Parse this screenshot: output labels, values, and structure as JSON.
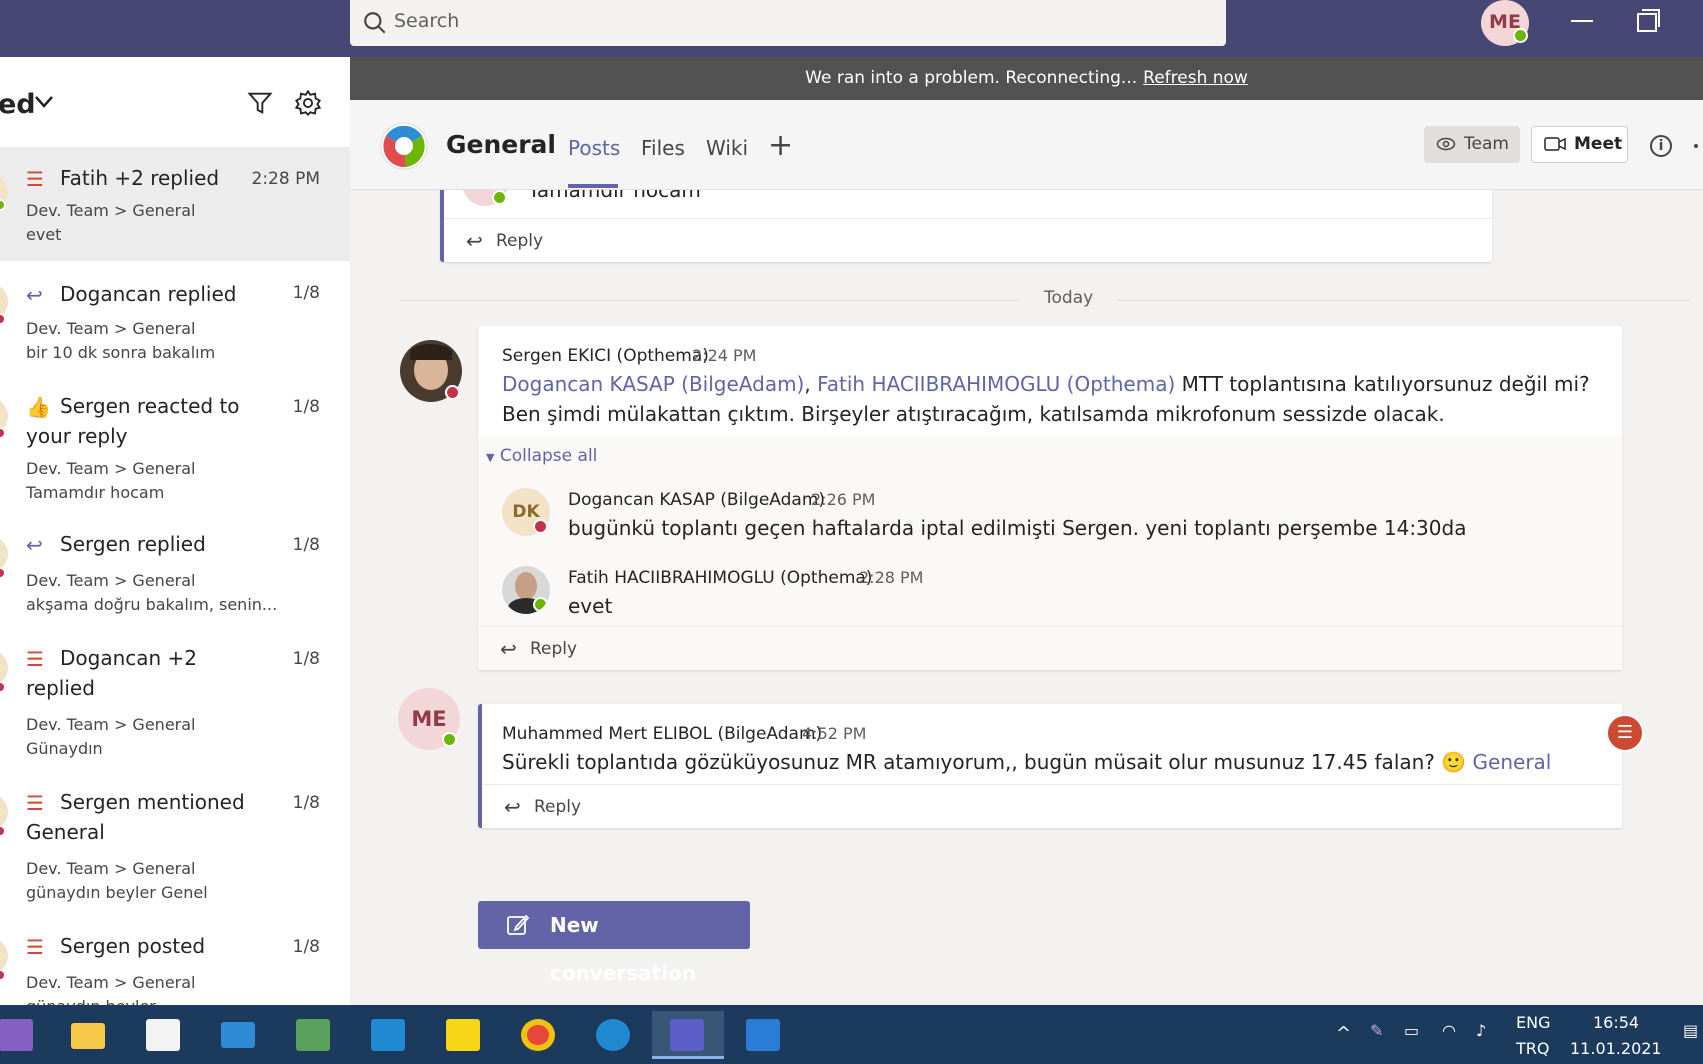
{
  "search": {
    "placeholder": "Search"
  },
  "user": {
    "initials": "ME"
  },
  "activity": {
    "header_title": "ed",
    "items": [
      {
        "title": "Fatih +2 replied",
        "time": "2:28 PM",
        "path": "Dev. Team > General",
        "snippet": "evet",
        "icon": "thread-icon"
      },
      {
        "title": "Dogancan replied",
        "time": "1/8",
        "path": "Dev. Team > General",
        "snippet": "bir 10 dk sonra bakalım",
        "icon": "reply-icon"
      },
      {
        "title": "Sergen reacted to your reply",
        "time": "1/8",
        "path": "Dev. Team > General",
        "snippet": "Tamamdır hocam",
        "icon": "like-icon"
      },
      {
        "title": "Sergen replied",
        "time": "1/8",
        "path": "Dev. Team > General",
        "snippet": "akşama doğru bakalım, senin...",
        "icon": "reply-icon"
      },
      {
        "title": "Dogancan +2 replied",
        "time": "1/8",
        "path": "Dev. Team > General",
        "snippet": "Günaydın",
        "icon": "thread-icon"
      },
      {
        "title": "Sergen mentioned General",
        "time": "1/8",
        "path": "Dev. Team > General",
        "snippet": "günaydın beyler Genel",
        "icon": "mention-icon"
      },
      {
        "title": "Sergen posted",
        "time": "1/8",
        "path": "Dev. Team > General",
        "snippet": "günaydın beyler",
        "icon": "thread-icon"
      }
    ]
  },
  "banner": {
    "text": "We ran into a problem. Reconnecting...",
    "link": "Refresh now"
  },
  "channel": {
    "title": "General",
    "tabs": [
      "Posts",
      "Files",
      "Wiki"
    ],
    "team_label": "Team",
    "meet_label": "Meet"
  },
  "posts": {
    "top_reply": {
      "avatar": "ME",
      "text": "Tamamdır hocam",
      "reply_label": "Reply"
    },
    "separator": "Today",
    "thread": {
      "author": "Sergen EKICI (Opthema)",
      "time": "2:24 PM",
      "mention1": "Dogancan KASAP (BilgeAdam)",
      "comma": ",",
      "mention2": "Fatih HACIIBRAHIMOGLU (Opthema)",
      "line1_rest": "MTT toplantısına katılıyorsunuz değil mi?",
      "line2": "Ben şimdi mülakattan çıktım. Birşeyler atıştıracağım, katılsamda mikrofonum sessizde olacak.",
      "collapse_label": "Collapse all",
      "replies": [
        {
          "initials": "DK",
          "author": "Dogancan KASAP (BilgeAdam)",
          "time": "2:26 PM",
          "text": "bugünkü toplantı geçen haftalarda iptal edilmişti Sergen. yeni toplantı perşembe 14:30da"
        },
        {
          "initials": "",
          "author": "Fatih HACIIBRAHIMOGLU (Opthema)",
          "time": "2:28 PM",
          "text": "evet"
        }
      ],
      "reply_label": "Reply"
    },
    "last": {
      "initials": "ME",
      "author": "Muhammed Mert ELIBOL (BilgeAdam)",
      "time": "4:52 PM",
      "text": "Sürekli toplantıda gözüküyosunuz MR atamıyorum,, bugün müsait olur musunuz 17.45 falan?",
      "emoji": "🙂",
      "mention": "General",
      "reply_label": "Reply"
    },
    "new_conversation": "New conversation"
  },
  "taskbar": {
    "lang_top": "ENG",
    "lang_bottom": "TRQ",
    "time": "16:54",
    "date": "11.01.2021",
    "apps": [
      "visual-studio-icon",
      "file-explorer-icon",
      "store-icon",
      "mail-icon",
      "snipping-icon",
      "vscode-icon",
      "sticky-notes-icon",
      "chrome-icon",
      "edge-icon",
      "teams-icon",
      "photos-icon"
    ]
  },
  "colors": {
    "accent": "#6264a7",
    "topbar": "#464775",
    "alert": "#cc4a31",
    "online": "#6bb700",
    "busy": "#c4314b"
  }
}
